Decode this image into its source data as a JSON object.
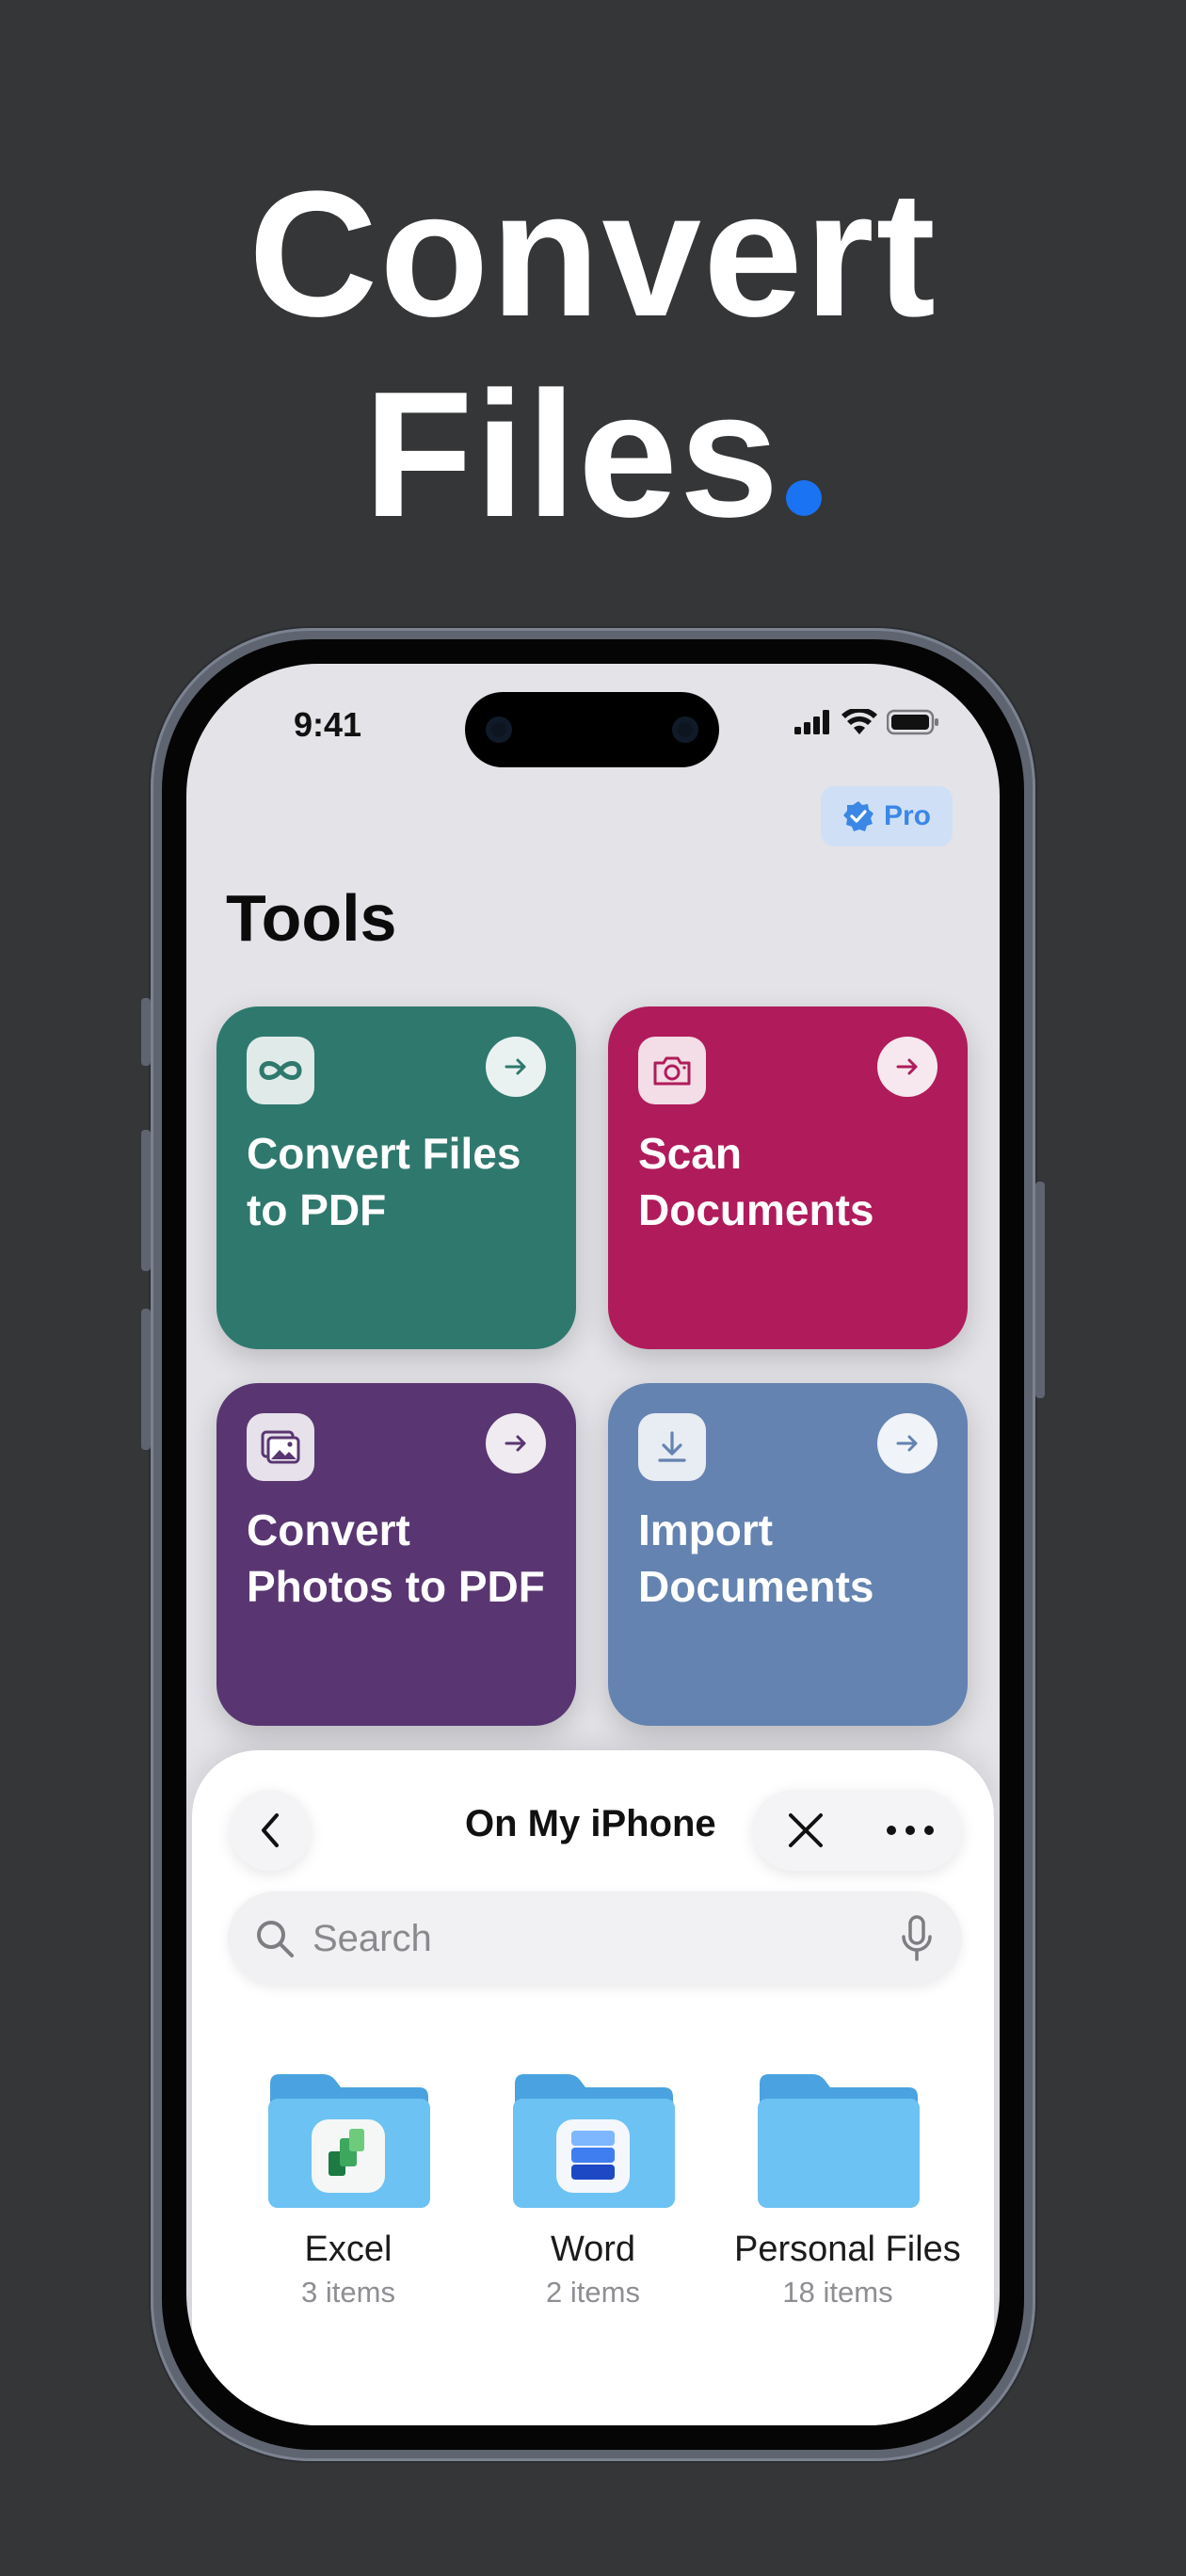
{
  "headline": {
    "line1": "Convert",
    "line2": "Files"
  },
  "status_bar": {
    "time": "9:41"
  },
  "pro_badge": {
    "label": "Pro"
  },
  "page_title": "Tools",
  "tools": [
    {
      "label": "Convert Files to PDF",
      "icon": "infinity-icon",
      "color": "#2f786d"
    },
    {
      "label": "Scan Documents",
      "icon": "camera-icon",
      "color": "#b01c5b"
    },
    {
      "label": "Convert Photos to PDF",
      "icon": "photos-icon",
      "color": "#593671"
    },
    {
      "label": "Import Documents",
      "icon": "download-icon",
      "color": "#6483b0"
    }
  ],
  "files_sheet": {
    "title": "On My iPhone",
    "search_placeholder": "Search",
    "folders": [
      {
        "name": "Excel",
        "count": "3 items",
        "app_icon": "excel-icon"
      },
      {
        "name": "Word",
        "count": "2 items",
        "app_icon": "word-icon"
      },
      {
        "name": "Personal Files",
        "count": "18 items",
        "app_icon": ""
      }
    ]
  },
  "colors": {
    "background": "#353638",
    "accent": "#1a73f2"
  }
}
